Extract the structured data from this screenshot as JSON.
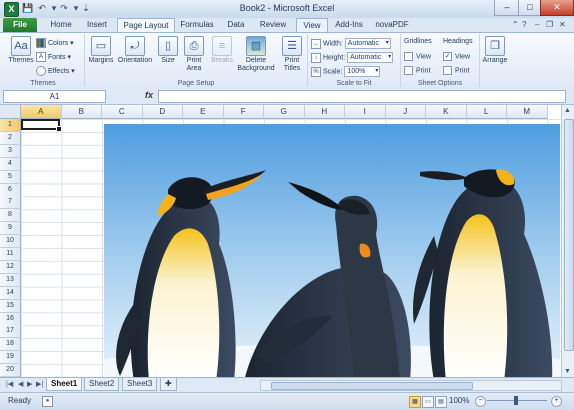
{
  "title": "Book2 - Microsoft Excel",
  "window": {
    "minimize": "–",
    "maximize": "□",
    "close": "✕",
    "ribbon_min": "⌃",
    "help": "?",
    "doc_min": "–",
    "doc_restore": "❐",
    "doc_close": "✕"
  },
  "quick_access": {
    "app_icon": "X",
    "save_icon": "save-icon",
    "undo_icon": "undo-icon",
    "redo_icon": "redo-icon",
    "customize_icon": "customize-icon"
  },
  "tabs": [
    "File",
    "Home",
    "Insert",
    "Page Layout",
    "Formulas",
    "Data",
    "Review",
    "View",
    "Add-Ins",
    "novaPDF"
  ],
  "active_tab": "Page Layout",
  "ribbon": {
    "themes": {
      "label": "Themes",
      "themes_btn": "Themes",
      "colors": "Colors",
      "fonts": "Fonts",
      "effects": "Effects"
    },
    "page_setup": {
      "label": "Page Setup",
      "margins": "Margins",
      "orientation": "Orientation",
      "size": "Size",
      "print_area": "Print Area",
      "breaks": "Breaks",
      "background": "Delete Background",
      "print_titles": "Print Titles"
    },
    "scale": {
      "label": "Scale to Fit",
      "width_label": "Width:",
      "width_value": "Automatic",
      "height_label": "Height:",
      "height_value": "Automatic",
      "scale_label": "Scale:",
      "scale_value": "100%"
    },
    "sheet_options": {
      "label": "Sheet Options",
      "gridlines": "Gridlines",
      "headings": "Headings",
      "view": "View",
      "print": "Print",
      "gridlines_view": false,
      "gridlines_print": false,
      "headings_view": true,
      "headings_print": false
    },
    "arrange": {
      "label": "Arrange"
    }
  },
  "formula_bar": {
    "name_box": "A1",
    "fx": "fx",
    "formula": ""
  },
  "columns": [
    "A",
    "B",
    "C",
    "D",
    "E",
    "F",
    "G",
    "H",
    "I",
    "J",
    "K",
    "L",
    "M"
  ],
  "rows": [
    "1",
    "2",
    "3",
    "4",
    "5",
    "6",
    "7",
    "8",
    "9",
    "10",
    "11",
    "12",
    "13",
    "14",
    "15",
    "16",
    "17",
    "18",
    "19",
    "20"
  ],
  "sheets": [
    "Sheet1",
    "Sheet2",
    "Sheet3"
  ],
  "active_sheet": "Sheet1",
  "status": {
    "ready": "Ready",
    "zoom": "100%"
  },
  "colors": {
    "accent": "#1f7a3e",
    "selection": "#f0c86a",
    "sky_top": "#3d8fd9",
    "sky_bottom": "#eaf4fc"
  }
}
